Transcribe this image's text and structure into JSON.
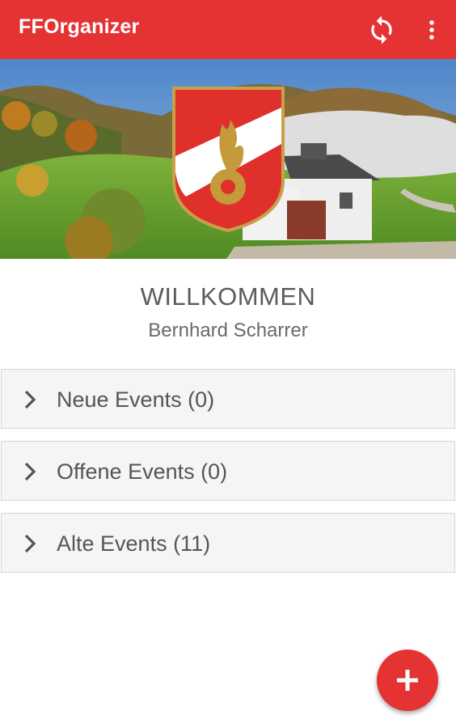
{
  "appbar": {
    "title": "FFOrganizer",
    "refresh_icon": "refresh-icon",
    "menu_icon": "more-vert-icon",
    "color": "#e53334"
  },
  "hero": {
    "image": "landscape with fire station and fire brigade coat of arms",
    "crest_icon": "fire-brigade-crest"
  },
  "welcome": {
    "title": "WILLKOMMEN",
    "user": "Bernhard Scharrer"
  },
  "sections": [
    {
      "label": "Neue Events (0)",
      "icon": "chevron-right-icon"
    },
    {
      "label": "Offene Events (0)",
      "icon": "chevron-right-icon"
    },
    {
      "label": "Alte Events (11)",
      "icon": "chevron-right-icon"
    }
  ],
  "fab": {
    "icon": "plus-icon",
    "color": "#e53334"
  }
}
